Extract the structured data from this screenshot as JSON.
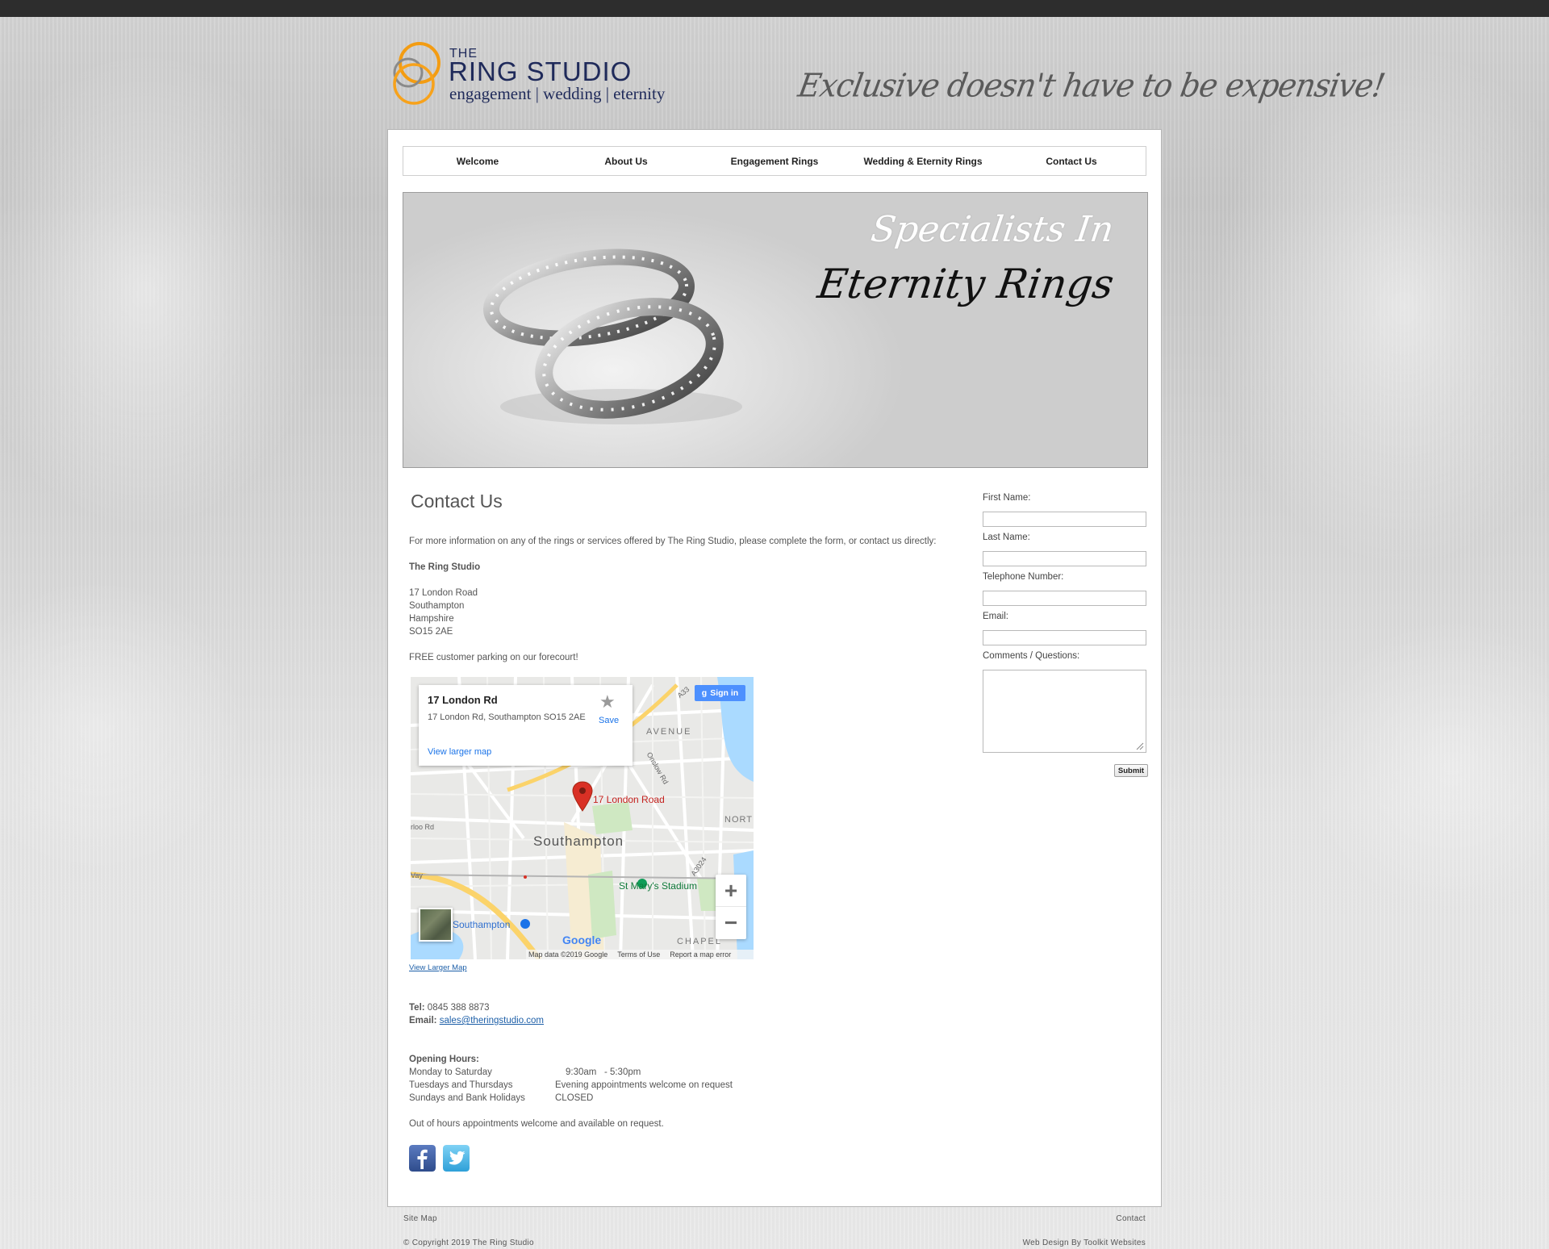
{
  "header": {
    "logo_the": "THE",
    "logo_name": "RING STUDIO",
    "logo_tagline": "engagement | wedding | eternity",
    "slogan": "Exclusive doesn't have to be expensive!"
  },
  "nav": {
    "items": [
      "Welcome",
      "About Us",
      "Engagement Rings",
      "Wedding & Eternity Rings",
      "Contact Us"
    ]
  },
  "banner": {
    "line1": "Specialists In",
    "line2": "Eternity Rings"
  },
  "content": {
    "title": "Contact Us",
    "intro": "For more information on any of the rings or services offered by The Ring Studio, please complete the form, or contact us directly:",
    "company": "The Ring Studio",
    "address": [
      "17 London Road",
      "Southampton",
      "Hampshire",
      "SO15 2AE"
    ],
    "parking": "FREE customer parking on our forecourt!",
    "view_larger_map": "View Larger Map",
    "tel_label": "Tel:",
    "tel_value": "0845 388 8873",
    "email_label": "Email:",
    "email_value": "sales@theringstudio.com",
    "hours_title": "Opening Hours:",
    "hours": [
      {
        "days": "Monday to Saturday",
        "time": "9:30am   - 5:30pm"
      },
      {
        "days": "Tuesdays and Thursdays",
        "time": "Evening appointments welcome on request"
      },
      {
        "days": "Sundays and Bank Holidays",
        "time": "CLOSED"
      }
    ],
    "out_of_hours": "Out of hours appointments welcome and available on request."
  },
  "map": {
    "card_title": "17 London Rd",
    "card_address": "17 London Rd, Southampton SO15 2AE",
    "card_link": "View larger map",
    "save": "Save",
    "sign_in": "Sign in",
    "pin_label": "17 London Road",
    "city_label": "Southampton",
    "stadium_label": "St Mary's Stadium",
    "station_label": "Southampton",
    "avenue_label": "AVENUE",
    "north_label": "NORT",
    "chapel_label": "CHAPEL",
    "road_onslow": "Onslow Rd",
    "road_a3024": "A3024",
    "road_a33": "A33",
    "road_loo": "rloo Rd",
    "road_way": "Vay",
    "google": "Google",
    "attrib_data": "Map data ©2019 Google",
    "attrib_terms": "Terms of Use",
    "attrib_report": "Report a map error"
  },
  "form": {
    "first_name": "First Name:",
    "last_name": "Last Name:",
    "telephone": "Telephone Number:",
    "email": "Email:",
    "comments": "Comments / Questions:",
    "submit": "Submit"
  },
  "footer": {
    "site_map": "Site Map",
    "contact": "Contact",
    "copyright": "© Copyright 2019 The Ring Studio",
    "credit": "Web Design By Toolkit Websites"
  },
  "colors": {
    "brand_navy": "#1f2a5a",
    "ring_orange": "#f39c12",
    "link_blue": "#1d5fa8",
    "map_pin": "#d93025"
  }
}
